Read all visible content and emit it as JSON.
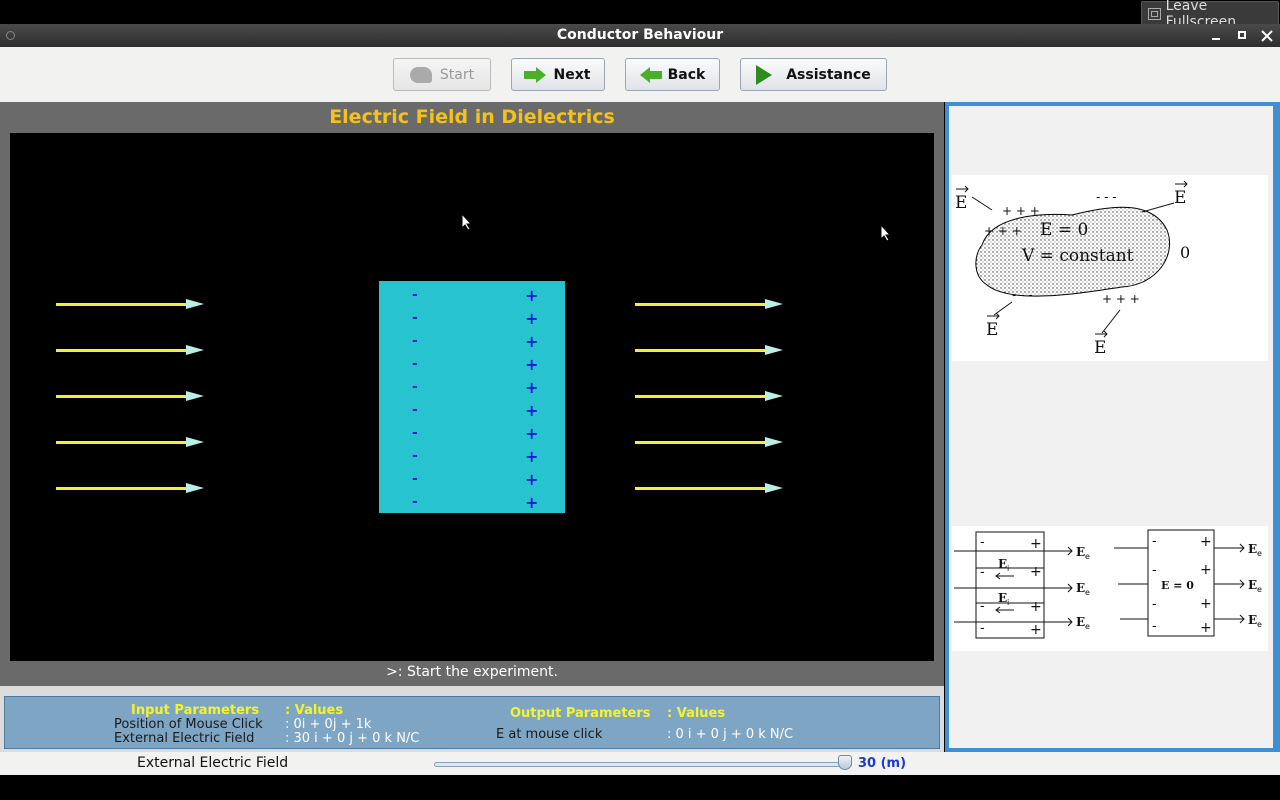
{
  "fullscreen": {
    "label": "Leave Fullscreen"
  },
  "window": {
    "title": "Conductor Behaviour"
  },
  "toolbar": {
    "start_label": "Start",
    "next_label": "Next",
    "back_label": "Back",
    "assistance_label": "Assistance"
  },
  "sim": {
    "title": "Electric Field in Dielectrics",
    "status": ">: Start the experiment.",
    "neg_charge": "-",
    "pos_charge": "+"
  },
  "figures": {
    "fig1": {
      "E": "E",
      "inside_field": "E = 0",
      "inside_potential": "V = constant",
      "zero": "0",
      "plus": "+ + +",
      "minus": "- - -"
    },
    "fig2": {
      "Ee": "E",
      "Ee_sub": "e",
      "Ei": "E",
      "Ei_sub": "i",
      "inside": "E = 0",
      "plus": "+",
      "minus": "-"
    }
  },
  "params": {
    "input_header": "Input Parameters",
    "values_header": ": Values",
    "input_rows": [
      {
        "label": "Position of Mouse Click",
        "value": ": 0i + 0j + 1k"
      },
      {
        "label": "External Electric Field",
        "value": ": 30 i + 0 j + 0 k N/C"
      }
    ],
    "output_header": "Output Parameters",
    "output_values_header": ": Values",
    "output_rows": [
      {
        "label": "E at mouse click",
        "value": ": 0 i + 0 j + 0 k N/C"
      }
    ]
  },
  "slider": {
    "label": "External Electric Field",
    "value_text": "30 (m)",
    "value": 30
  },
  "colors": {
    "title_color": "#f5c21a",
    "conductor": "#27c4cf",
    "field_line": "#f2ef3a",
    "charge": "#1a1ad6",
    "panel_blue": "#7ea6c4"
  }
}
